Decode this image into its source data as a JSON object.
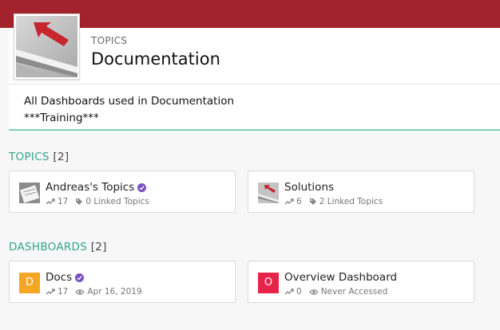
{
  "colors": {
    "banner": "#a3222c",
    "accent": "#33a38b",
    "verified": "#7b4fc4",
    "docs_tile": "#f5a623",
    "overview_tile": "#e8234a"
  },
  "header": {
    "eyebrow": "TOPICS",
    "title": "Documentation",
    "description_line1": "All Dashboards used in Documentation",
    "description_line2": "***Training***"
  },
  "topics_section": {
    "label": "TOPICS",
    "count": "[2]",
    "items": [
      {
        "name": "Andreas's Topics",
        "verified": true,
        "views": "17",
        "linked": "0 Linked Topics",
        "icon": "sticky-note-thumb"
      },
      {
        "name": "Solutions",
        "verified": false,
        "views": "6",
        "linked": "2 Linked Topics",
        "icon": "arrow-thumb"
      }
    ]
  },
  "dashboards_section": {
    "label": "DASHBOARDS",
    "count": "[2]",
    "items": [
      {
        "name": "Docs",
        "initial": "D",
        "verified": true,
        "views": "17",
        "accessed": "Apr 16, 2019"
      },
      {
        "name": "Overview Dashboard",
        "initial": "O",
        "verified": false,
        "views": "0",
        "accessed": "Never Accessed"
      }
    ]
  }
}
